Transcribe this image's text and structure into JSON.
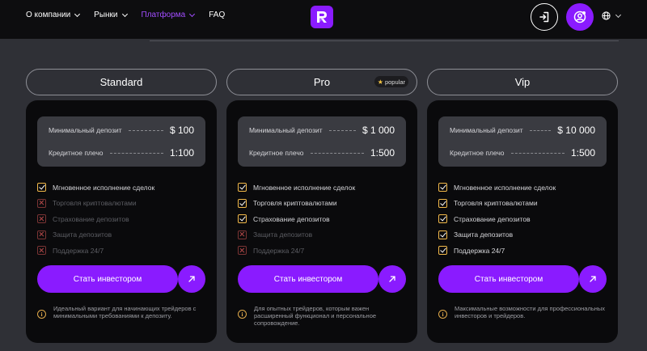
{
  "nav": {
    "items": [
      {
        "label": "О компании",
        "dropdown": true
      },
      {
        "label": "Рынки",
        "dropdown": true
      },
      {
        "label": "Платформа",
        "dropdown": true,
        "active": true
      },
      {
        "label": "FAQ",
        "dropdown": false
      }
    ]
  },
  "header": {
    "logo_icon": "brand-logo-icon",
    "login_icon": "login-icon",
    "account_icon": "account-icon",
    "language_icon": "globe-icon"
  },
  "colors": {
    "accent": "#8a1bff",
    "active_nav": "#a24dff",
    "check": "#f2b94a",
    "cross": "#b24848"
  },
  "plans": [
    {
      "name": "Standard",
      "badge": "",
      "terms": [
        {
          "label": "Минимальный депозит",
          "value": "$ 100"
        },
        {
          "label": "Кредитное плечо",
          "value": "1:100"
        }
      ],
      "features": [
        {
          "label": "Мгновенное исполнение сделок",
          "included": true
        },
        {
          "label": "Торговля криптовалютами",
          "included": false
        },
        {
          "label": "Страхование депозитов",
          "included": false
        },
        {
          "label": "Защита депозитов",
          "included": false
        },
        {
          "label": "Поддержка 24/7",
          "included": false
        }
      ],
      "cta": "Стать инвестором",
      "note": "Идеальный вариант для начинающих трейдеров с минимальными требованиями к депозиту."
    },
    {
      "name": "Pro",
      "badge": "popular",
      "terms": [
        {
          "label": "Минимальный депозит",
          "value": "$ 1 000"
        },
        {
          "label": "Кредитное плечо",
          "value": "1:500"
        }
      ],
      "features": [
        {
          "label": "Мгновенное исполнение сделок",
          "included": true
        },
        {
          "label": "Торговля криптовалютами",
          "included": true
        },
        {
          "label": "Страхование депозитов",
          "included": true
        },
        {
          "label": "Защита депозитов",
          "included": false
        },
        {
          "label": "Поддержка 24/7",
          "included": false
        }
      ],
      "cta": "Стать инвестором",
      "note": "Для опытных трейдеров, которым важен расширенный функционал и персональное сопровождение."
    },
    {
      "name": "Vip",
      "badge": "",
      "terms": [
        {
          "label": "Минимальный депозит",
          "value": "$ 10 000"
        },
        {
          "label": "Кредитное плечо",
          "value": "1:500"
        }
      ],
      "features": [
        {
          "label": "Мгновенное исполнение сделок",
          "included": true
        },
        {
          "label": "Торговля криптовалютами",
          "included": true
        },
        {
          "label": "Страхование депозитов",
          "included": true
        },
        {
          "label": "Защита депозитов",
          "included": true
        },
        {
          "label": "Поддержка 24/7",
          "included": true
        }
      ],
      "cta": "Стать инвестором",
      "note": "Максимальные возможности для профессиональных инвесторов и трейдеров."
    }
  ]
}
